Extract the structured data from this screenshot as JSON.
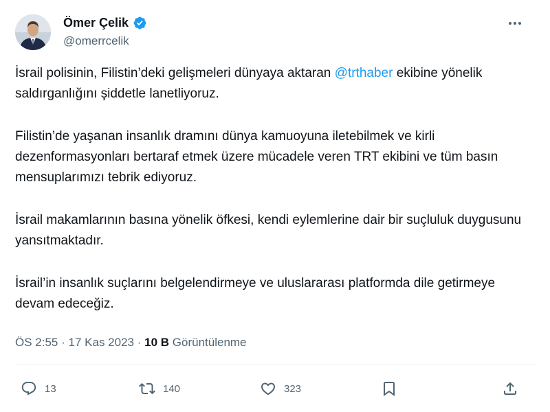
{
  "author": {
    "display_name": "Ömer Çelik",
    "handle": "@omerrcelik",
    "verified": true,
    "verified_color": "#1d9bf0"
  },
  "tweet": {
    "paragraphs": [
      {
        "pre": "İsrail polisinin, Filistin’deki gelişmeleri dünyaya aktaran ",
        "mention": "@trthaber",
        "post": " ekibine yönelik saldırganlığını şiddetle lanetliyoruz."
      },
      {
        "text": "Filistin’de yaşanan insanlık dramını dünya kamuoyuna iletebilmek ve kirli dezenformasyonları bertaraf etmek üzere mücadele veren TRT ekibini ve tüm basın mensuplarımızı tebrik ediyoruz."
      },
      {
        "text": "İsrail makamlarının basına yönelik öfkesi, kendi eylemlerine dair bir suçluluk duygusunu yansıtmaktadır."
      },
      {
        "text": "İsrail’in insanlık suçlarını belgelendirmeye ve uluslararası platformda dile getirmeye devam edeceğiz."
      }
    ],
    "mention_color": "#1d9bf0"
  },
  "meta": {
    "time": "ÖS 2:55",
    "separator": "·",
    "date": "17 Kas 2023",
    "views_count": "10 B",
    "views_label": "Görüntülenme"
  },
  "actions": {
    "reply": {
      "icon": "reply-icon",
      "count": "13"
    },
    "retweet": {
      "icon": "retweet-icon",
      "count": "140"
    },
    "like": {
      "icon": "heart-icon",
      "count": "323"
    },
    "bookmark": {
      "icon": "bookmark-icon"
    },
    "share": {
      "icon": "share-icon"
    }
  }
}
